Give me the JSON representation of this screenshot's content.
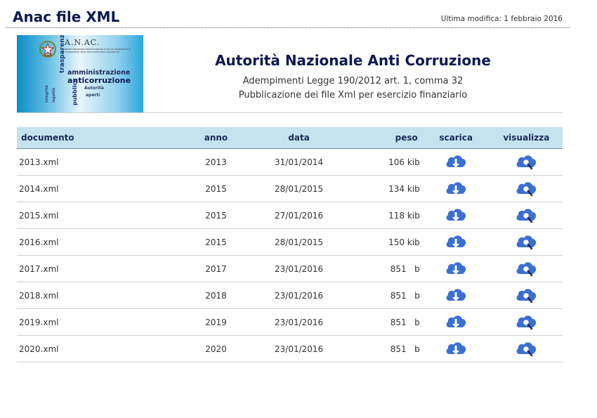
{
  "header": {
    "title": "Anac file XML",
    "last_modified": "Ultima modifica: 1 febbraio 2016"
  },
  "banner": {
    "logo_text": "A.N.AC.",
    "caption": "Autorità Nazionale Anticorruzione e per la valutazione e la trasparenza delle amministrazioni pubbliche",
    "words": [
      "trasparenza",
      "amministrazione",
      "anticorruzione",
      "pubblica",
      "Autorità",
      "aperti",
      "integrità",
      "legalità"
    ]
  },
  "intro": {
    "org_name": "Autorità Nazionale Anti Corruzione",
    "line1": "Adempimenti Legge 190/2012 art. 1, comma 32",
    "line2": "Pubblicazione dei file Xml per esercizio finanziario"
  },
  "table": {
    "columns": {
      "documento": "documento",
      "anno": "anno",
      "data": "data",
      "peso": "peso",
      "scarica": "scarica",
      "visualizza": "visualizza"
    },
    "rows": [
      {
        "documento": "2013.xml",
        "anno": "2013",
        "data": "31/01/2014",
        "peso": "106 kib"
      },
      {
        "documento": "2014.xml",
        "anno": "2015",
        "data": "28/01/2015",
        "peso": "134 kib"
      },
      {
        "documento": "2015.xml",
        "anno": "2015",
        "data": "27/01/2016",
        "peso": "118 kib"
      },
      {
        "documento": "2016.xml",
        "anno": "2015",
        "data": "28/01/2015",
        "peso": "150 kib"
      },
      {
        "documento": "2017.xml",
        "anno": "2017",
        "data": "23/01/2016",
        "peso": "851   b"
      },
      {
        "documento": "2018.xml",
        "anno": "2018",
        "data": "23/01/2016",
        "peso": "851   b"
      },
      {
        "documento": "2019.xml",
        "anno": "2019",
        "data": "23/01/2016",
        "peso": "851   b"
      },
      {
        "documento": "2020.xml",
        "anno": "2020",
        "data": "23/01/2016",
        "peso": "851   b"
      }
    ]
  },
  "icons": {
    "download": "cloud-download-icon",
    "view": "cloud-search-icon",
    "color": "#3b6fd4"
  }
}
